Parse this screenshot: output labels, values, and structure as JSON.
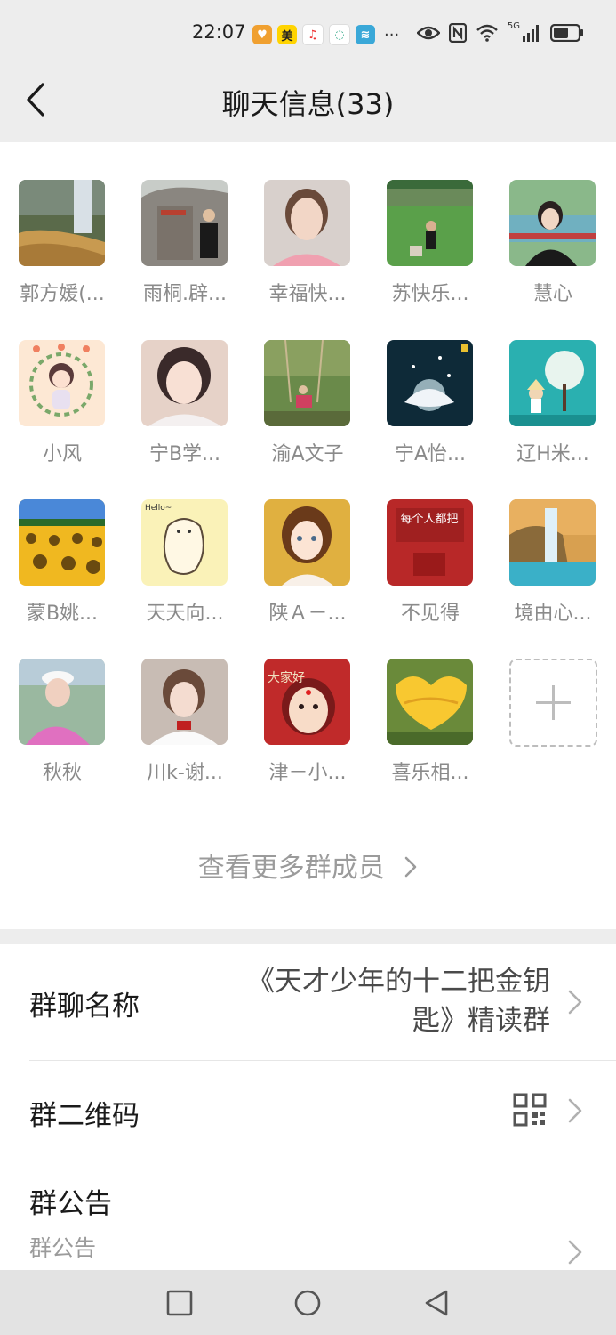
{
  "status": {
    "time": "22:07",
    "notif_more": "···",
    "network": "5G"
  },
  "header": {
    "title": "聊天信息(33)"
  },
  "members": [
    {
      "name": "郭方媛(..."
    },
    {
      "name": "雨桐.辟..."
    },
    {
      "name": "幸福快..."
    },
    {
      "name": "苏快乐..."
    },
    {
      "name": "慧心"
    },
    {
      "name": "小风"
    },
    {
      "name": "宁B学..."
    },
    {
      "name": "渝A文子"
    },
    {
      "name": "宁A怡..."
    },
    {
      "name": "辽H米..."
    },
    {
      "name": "蒙B姚..."
    },
    {
      "name": "天天向..."
    },
    {
      "name": "陕Ａ－..."
    },
    {
      "name": "不见得"
    },
    {
      "name": "境由心..."
    },
    {
      "name": "秋秋"
    },
    {
      "name": "川k-谢..."
    },
    {
      "name": "津－小..."
    },
    {
      "name": "喜乐相..."
    }
  ],
  "view_more": "查看更多群成员",
  "settings": {
    "group_name_label": "群聊名称",
    "group_name_line1": "《天才少年的十二把金钥",
    "group_name_line2": "匙》精读群",
    "qr_label": "群二维码",
    "notice_label": "群公告",
    "notice_value": "群公告"
  },
  "avatar_texts": {
    "hello": "Hello~",
    "poster": "每个人都把",
    "dajia": "大家好"
  }
}
